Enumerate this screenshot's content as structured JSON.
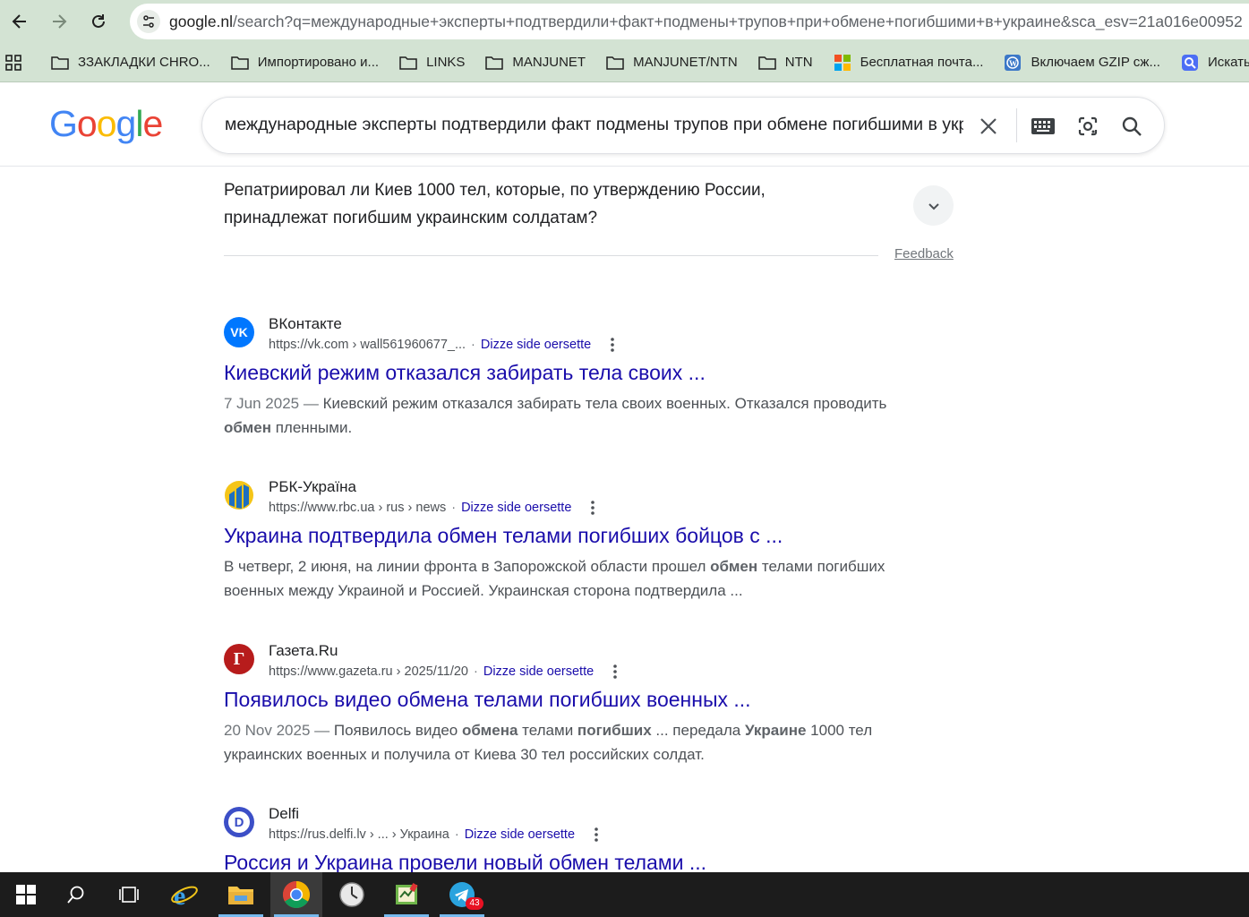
{
  "browser": {
    "url_host": "google.nl",
    "url_rest": "/search?q=международные+эксперты+подтвердили+факт+подмены+трупов+при+обмене+погибшими+в+украине&sca_esv=21a016e00952",
    "bookmarks": [
      {
        "label": "ЗЗАКЛАДКИ CHRO...",
        "icon": "folder-icon"
      },
      {
        "label": "Импортировано и...",
        "icon": "folder-icon"
      },
      {
        "label": "LINKS",
        "icon": "folder-icon"
      },
      {
        "label": "MANJUNET",
        "icon": "folder-icon"
      },
      {
        "label": "MANJUNET/NTN",
        "icon": "folder-icon"
      },
      {
        "label": "NTN",
        "icon": "folder-icon"
      },
      {
        "label": "Бесплатная почта...",
        "icon": "microsoft-icon"
      },
      {
        "label": "Включаем GZIP сж...",
        "icon": "wordpress-icon"
      },
      {
        "label": "Искать в",
        "icon": "search-app-icon"
      }
    ]
  },
  "search": {
    "logo": [
      "G",
      "o",
      "o",
      "g",
      "l",
      "e"
    ],
    "query": "международные эксперты подтвердили факт подмены трупов при обмене погибшими в украине"
  },
  "paa": {
    "question": "Репатриировал ли Киев 1000 тел, которые, по утверждению России, принадлежат погибшим украинским солдатам?",
    "feedback": "Feedback"
  },
  "results": [
    {
      "source": "ВКонтакте",
      "url": "https://vk.com › wall561960677_...",
      "translate": "Dizze side oersette",
      "title": "Киевский режим отказался забирать тела своих ...",
      "snippet_date": "7 Jun 2025 — ",
      "snippet_1": "Киевский режим отказался забирать тела своих военных. Отказался проводить ",
      "snippet_b1": "обмен",
      "snippet_2": " пленными.",
      "favicon": {
        "color": "#0077ff",
        "glyph": "VK"
      }
    },
    {
      "source": "РБК-Україна",
      "url": "https://www.rbc.ua › rus › news",
      "translate": "Dizze side oersette",
      "title": "Украина подтвердила обмен телами погибших бойцов с ...",
      "snippet_1": "В четверг, 2 июня, на линии фронта в Запорожской области прошел ",
      "snippet_b1": "обмен",
      "snippet_2": " телами погибших военных между Украиной и Россией. Украинская сторона подтвердила ...",
      "favicon": {
        "color": "#1a73c8",
        "glyph": ""
      }
    },
    {
      "source": "Газета.Ru",
      "url": "https://www.gazeta.ru › 2025/11/20",
      "translate": "Dizze side oersette",
      "title": "Появилось видео обмена телами погибших военных ...",
      "snippet_date": "20 Nov 2025 — ",
      "snippet_1": "Появилось видео ",
      "snippet_b1": "обмена",
      "snippet_2": " телами ",
      "snippet_b2": "погибших",
      "snippet_3": " ... передала ",
      "snippet_b3": "Украине",
      "snippet_4": " 1000 тел украинских военных и получила от Киева 30 тел российских солдат.",
      "favicon": {
        "color": "#b71c1c",
        "glyph": "Г"
      }
    },
    {
      "source": "Delfi",
      "url": "https://rus.delfi.lv › ... › Украина",
      "translate": "Dizze side oersette",
      "title": "Россия и Украина провели новый обмен телами ...",
      "favicon": {
        "color": "#3c4fc7",
        "glyph": "D"
      }
    }
  ],
  "taskbar": {
    "telegram_badge": "43"
  }
}
